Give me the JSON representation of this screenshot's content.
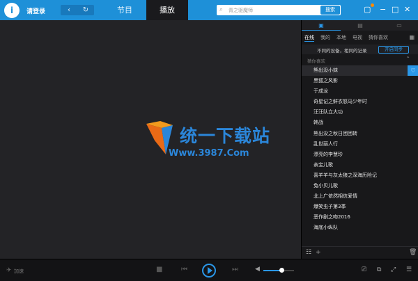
{
  "header": {
    "logo_text": "i",
    "login_label": "请登录",
    "back_icon": "‹",
    "refresh_icon": "↻",
    "tabs": [
      {
        "label": "节目"
      },
      {
        "label": "播放"
      }
    ],
    "search": {
      "placeholder": "青之驱魔师",
      "button_label": "搜索"
    }
  },
  "video": {
    "watermark_title": "统一下载站",
    "watermark_site": "Www.3987.Com"
  },
  "panel": {
    "subtabs": [
      "在线",
      "我的",
      "本地",
      "电视",
      "猜你喜欢"
    ],
    "sync_message": "不同的设备，相同的记录",
    "sync_button": "开启同步",
    "section_label": "猜你喜欢",
    "items": [
      "熊出没小妹",
      "黑狐之风影",
      "于成龙",
      "奇星记之鲜衣怒马少年时",
      "汪汪队立大功",
      "韩战",
      "熊出没之秋日团团转",
      "乱世丽人行",
      "漂亮的李慧珍",
      "亲宝儿歌",
      "喜羊羊与灰太狼之深海历险记",
      "兔小贝儿歌",
      "北上广依然相信爱情",
      "爆笑虫子第3季",
      "恶作剧之吻2016",
      "海底小纵队"
    ]
  },
  "bottom": {
    "accelerate_label": "加速",
    "volume_level": 0.6
  }
}
